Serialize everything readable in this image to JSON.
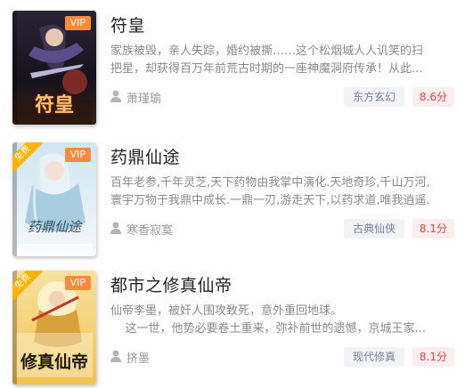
{
  "books": [
    {
      "title": "符皇",
      "badge": "VIP",
      "free_badge": "",
      "cover_text": "符皇",
      "desc_line1": "家族被毁，亲人失踪，婚约被撕……这个松烟城人人讥笑的扫",
      "desc_line2": "把星，却获得百万年前荒古时期的一座神魔洞府传承！从此...",
      "author": "萧瑾瑜",
      "category": "东方玄幻",
      "score": "8.6分",
      "cover_colors": {
        "bg": "#1b1a22",
        "accent": "#d24b2c",
        "light": "#7a6cff"
      }
    },
    {
      "title": "药鼎仙途",
      "badge": "VIP",
      "free_badge": "免费",
      "cover_text": "药鼎仙途",
      "desc_line1": "百年老参,千年灵芝,天下药物由我掌中演化.天地奇珍,千山万河,",
      "desc_line2": "寰宇万物于我鼎中成长.一鼎一刃,游走天下,以药求道,唯我逍遥.",
      "author": "寒香寂寞",
      "category": "古典仙侠",
      "score": "8.1分",
      "cover_colors": {
        "bg": "#e8f3f8",
        "accent": "#6aa7c6",
        "light": "#ffffff"
      }
    },
    {
      "title": "都市之修真仙帝",
      "badge": "VIP",
      "free_badge": "免费",
      "cover_text": "修真仙帝",
      "desc_line1": "仙帝李墨，被奸人围攻致死，意外重回地球。",
      "desc_line2": "    这一世，他势必要卷土重来，弥补前世的遗憾，京城王家...",
      "author": "挤墨",
      "category": "现代修真",
      "score": "8.1分",
      "cover_colors": {
        "bg": "#f4d27a",
        "accent": "#b3261e",
        "light": "#fff3c4"
      }
    }
  ]
}
